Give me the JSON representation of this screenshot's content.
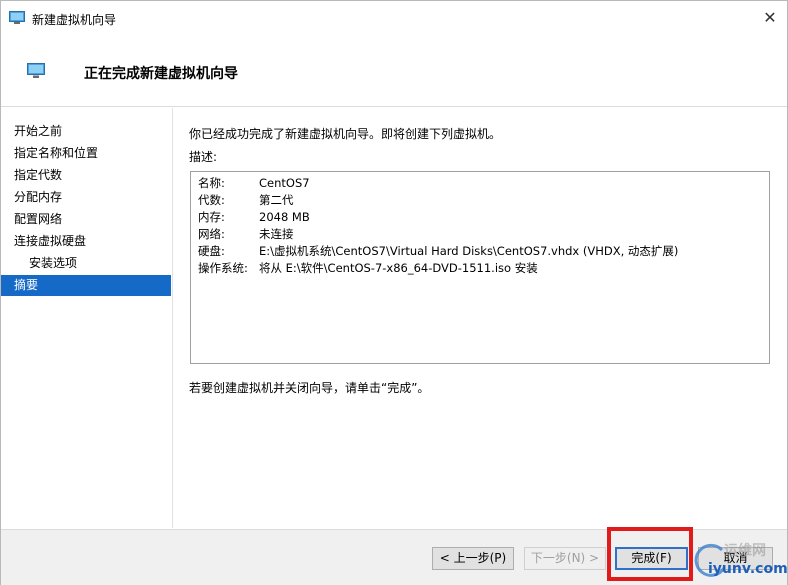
{
  "window": {
    "title": "新建虚拟机向导",
    "header_title": "正在完成新建虚拟机向导"
  },
  "sidebar": {
    "items": [
      {
        "label": "开始之前"
      },
      {
        "label": "指定名称和位置"
      },
      {
        "label": "指定代数"
      },
      {
        "label": "分配内存"
      },
      {
        "label": "配置网络"
      },
      {
        "label": "连接虚拟硬盘"
      },
      {
        "label": "安装选项"
      },
      {
        "label": "摘要"
      }
    ]
  },
  "main": {
    "intro": "你已经成功完成了新建虚拟机向导。即将创建下列虚拟机。",
    "description_label": "描述:",
    "summary": [
      {
        "key": "名称:",
        "value": "CentOS7"
      },
      {
        "key": "代数:",
        "value": "第二代"
      },
      {
        "key": "内存:",
        "value": "2048 MB"
      },
      {
        "key": "网络:",
        "value": "未连接"
      },
      {
        "key": "硬盘:",
        "value": "E:\\虚拟机系统\\CentOS7\\Virtual Hard Disks\\CentOS7.vhdx (VHDX, 动态扩展)"
      },
      {
        "key": "操作系统:",
        "value": "将从 E:\\软件\\CentOS-7-x86_64-DVD-1511.iso 安装"
      }
    ],
    "footer_hint": "若要创建虚拟机并关闭向导，请单击“完成”。"
  },
  "buttons": {
    "previous": "< 上一步(P)",
    "next": "下一步(N) >",
    "finish": "完成(F)",
    "cancel": "取消"
  },
  "watermark": {
    "top": "运维网",
    "bottom": "iyunv.com"
  },
  "colors": {
    "selected": "#1569c7",
    "highlight": "#e11a1a",
    "primary_border": "#2f71c8"
  }
}
